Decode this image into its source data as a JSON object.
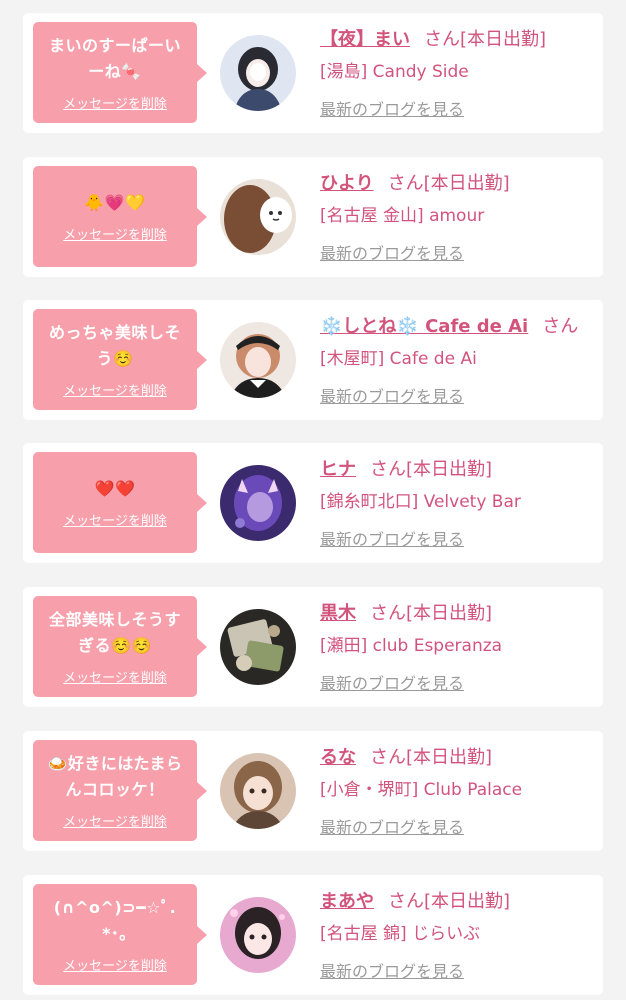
{
  "delete_label": "メッセージを削除",
  "blog_label": "最新のブログを見る",
  "honorific": "さん",
  "cards": [
    {
      "message": "まいのすーぱーいーね🍬",
      "name": "【夜】まい",
      "status": "[本日出勤]",
      "shop": "[湯島] Candy Side",
      "avatar_icon": "girl-portrait-blue"
    },
    {
      "message": "🐥💗💛",
      "name": "ひより",
      "status": "[本日出勤]",
      "shop": "[名古屋 金山] amour",
      "avatar_icon": "girl-portrait-brown"
    },
    {
      "message": "めっちゃ美味しそう☺️",
      "name": "❄️しとね❄️ Cafe de Ai",
      "status": "",
      "shop": "[木屋町] Cafe de Ai",
      "avatar_icon": "girl-portrait-maid"
    },
    {
      "message": "❤️❤️",
      "name": "ヒナ",
      "status": "[本日出勤]",
      "shop": "[錦糸町北口] Velvety Bar",
      "avatar_icon": "girl-portrait-purple"
    },
    {
      "message": "全部美味しそうすぎる☺️☺️",
      "name": "黒木",
      "status": "[本日出勤]",
      "shop": "[瀬田] club Esperanza",
      "avatar_icon": "food-photo"
    },
    {
      "message": "🍛好きにはたまらんコロッケ！",
      "name": "るな",
      "status": "[本日出勤]",
      "shop": "[小倉・堺町] Club Palace",
      "avatar_icon": "girl-portrait-tan"
    },
    {
      "message": "(∩^o^)⊃━☆ﾟ.*･｡",
      "name": "まあや",
      "status": "[本日出勤]",
      "shop": "[名古屋 錦] じらいぶ",
      "avatar_icon": "girl-portrait-pink"
    }
  ],
  "colors": {
    "accent": "#d2547d",
    "bubble": "#f7a0ac",
    "muted": "#9a9a9a",
    "background": "#f3f3f3"
  }
}
